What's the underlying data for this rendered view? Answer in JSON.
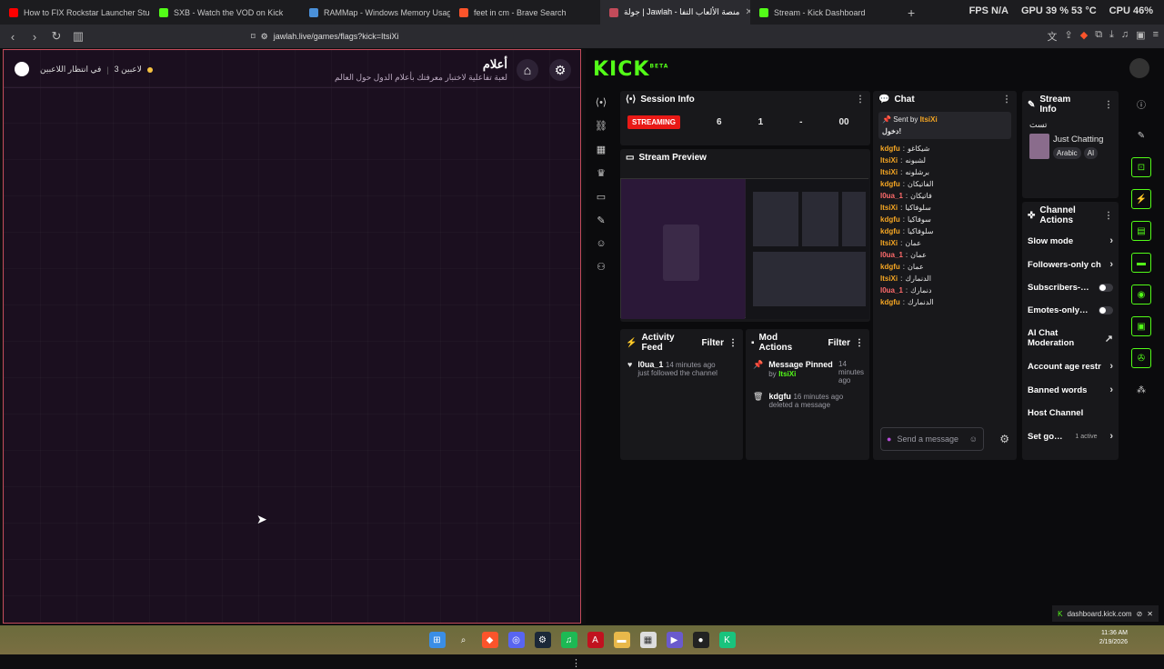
{
  "tabs": [
    {
      "title": "How to FIX Rockstar Launcher Stuck",
      "color": "#ff0000",
      "active": false
    },
    {
      "title": "SXB - Watch the VOD on Kick",
      "color": "#53fc18",
      "active": false
    },
    {
      "title": "RAMMap - Windows Memory Usage",
      "color": "#4a90d9",
      "active": false
    },
    {
      "title": "feet in cm - Brave Search",
      "color": "#fb542b",
      "active": false
    },
    {
      "title": "جولة | Jawlah - منصة الألعاب التفا",
      "color": "#c24b5a",
      "active": true
    },
    {
      "title": "Stream - Kick Dashboard",
      "color": "#53fc18",
      "active": false
    }
  ],
  "overlay": {
    "fps": "FPS",
    "fps_val": "N/A",
    "gpu": "GPU",
    "gpu_val": "39 % 53 °C",
    "cpu": "CPU",
    "cpu_val": "46%"
  },
  "url": "jawlah.live/games/flags?kick=ItsiXi",
  "game": {
    "title": "أعلام",
    "subtitle": "لعبة تفاعلية لاختبار معرفتك بأعلام الدول حول العالم",
    "players": "3 لاعبين",
    "waiting": "في انتظار اللاعبين"
  },
  "kick": {
    "logo": "KICK",
    "beta": "BETA",
    "session": {
      "title": "Session Info",
      "status": "STREAMING",
      "v1": "6",
      "v2": "1",
      "v3": "-",
      "v4": "00"
    },
    "preview_title": "Stream Preview",
    "chat": {
      "title": "Chat",
      "pinned_by": "Sent by",
      "pinned_user": "ItsiXi",
      "pinned_msg": "دخول!",
      "lines": [
        {
          "user": "kdgfu",
          "msg": "شيكاغو",
          "c": "u1"
        },
        {
          "user": "ItsiXi",
          "msg": "لشبونه",
          "c": "u1"
        },
        {
          "user": "ItsiXi",
          "msg": "برشلونه",
          "c": "u1"
        },
        {
          "user": "kdgfu",
          "msg": "الفاتيكان",
          "c": "u1"
        },
        {
          "user": "l0ua_1",
          "msg": "فاتيكان",
          "c": "u3"
        },
        {
          "user": "ItsiXi",
          "msg": "سلوفاكيا",
          "c": "u1"
        },
        {
          "user": "kdgfu",
          "msg": "سوفاكيا",
          "c": "u1"
        },
        {
          "user": "kdgfu",
          "msg": "سلوفاكيا",
          "c": "u1"
        },
        {
          "user": "ItsiXi",
          "msg": "عمان",
          "c": "u1"
        },
        {
          "user": "l0ua_1",
          "msg": "عمان",
          "c": "u3"
        },
        {
          "user": "kdgfu",
          "msg": "عمان",
          "c": "u1"
        },
        {
          "user": "ItsiXi",
          "msg": "الدنمارك",
          "c": "u1"
        },
        {
          "user": "l0ua_1",
          "msg": "دنمارك",
          "c": "u3"
        },
        {
          "user": "kdgfu",
          "msg": "الدنمارك",
          "c": "u1"
        }
      ],
      "send_placeholder": "Send a message"
    },
    "stream_info": {
      "title": "Stream Info",
      "tag": "تست",
      "category": "Just Chatting",
      "lang": "Arabic",
      "ai": "AI"
    },
    "channel_actions": {
      "title": "Channel Actions",
      "items": [
        {
          "label": "Slow mode",
          "kind": "chev"
        },
        {
          "label": "Followers-only ch",
          "kind": "chev"
        },
        {
          "label": "Subscribers-…",
          "kind": "toggle"
        },
        {
          "label": "Emotes-only…",
          "kind": "toggle"
        },
        {
          "label": "AI Chat Moderation",
          "kind": "ext"
        },
        {
          "label": "Account age restr",
          "kind": "chev"
        },
        {
          "label": "Banned words",
          "kind": "chev"
        },
        {
          "label": "Host Channel",
          "kind": "none"
        },
        {
          "label": "Set go…",
          "kind": "chev",
          "extra": "1 active"
        }
      ]
    },
    "activity": {
      "title": "Activity Feed",
      "filter": "Filter",
      "user": "l0ua_1",
      "time": "14 minutes ago",
      "event": "just followed the channel"
    },
    "mod": {
      "title": "Mod Actions",
      "filter": "Filter",
      "a1_title": "Message Pinned",
      "a1_by": "by",
      "a1_user": "ItsiXi",
      "a1_time": "14 minutes ago",
      "a2_user": "kdgfu",
      "a2_time": "16 minutes ago",
      "a2_event": "deleted a message"
    },
    "dash_url": "dashboard.kick.com"
  },
  "clock": {
    "time": "11:36 AM",
    "date": "2/19/2026"
  }
}
